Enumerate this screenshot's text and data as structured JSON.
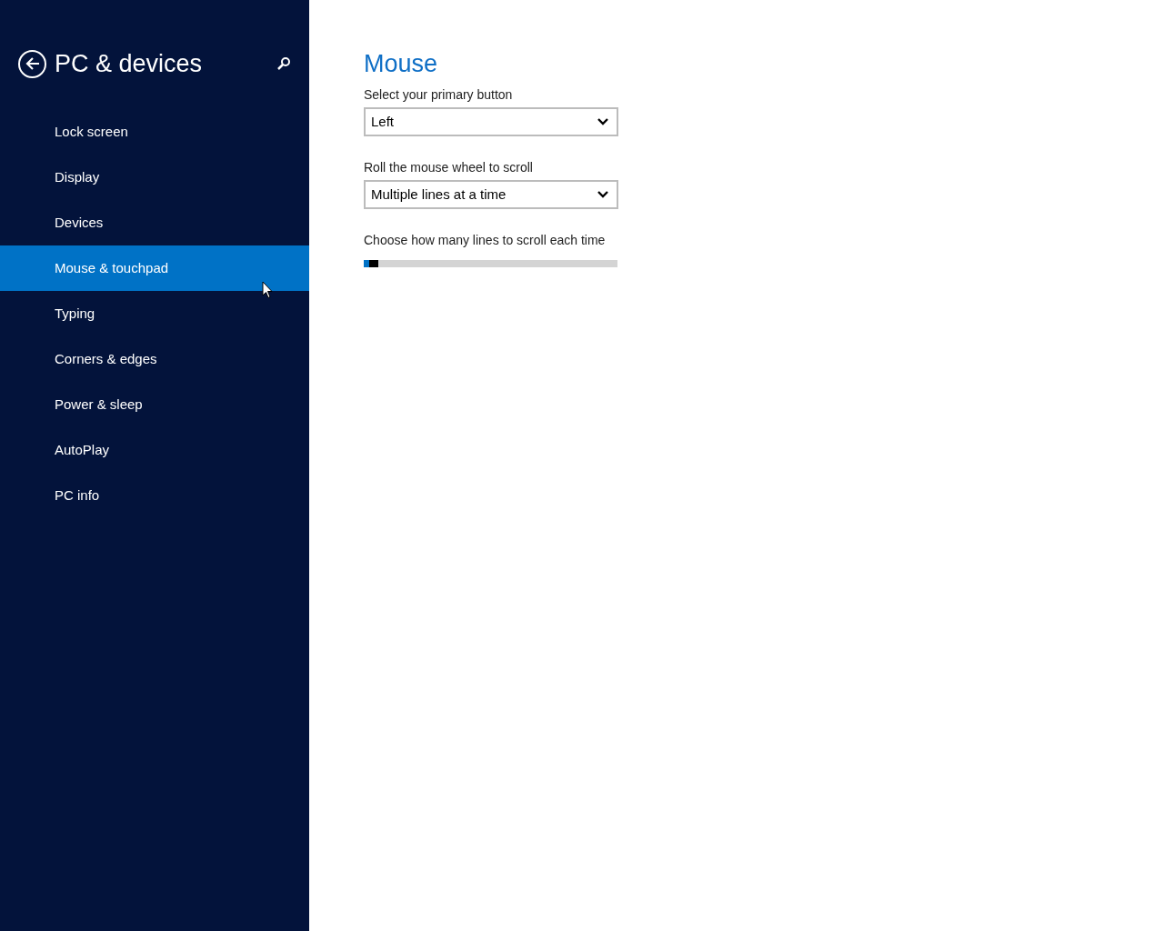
{
  "sidebar": {
    "title": "PC & devices",
    "items": [
      {
        "label": "Lock screen",
        "selected": false
      },
      {
        "label": "Display",
        "selected": false
      },
      {
        "label": "Devices",
        "selected": false
      },
      {
        "label": "Mouse & touchpad",
        "selected": true
      },
      {
        "label": "Typing",
        "selected": false
      },
      {
        "label": "Corners & edges",
        "selected": false
      },
      {
        "label": "Power & sleep",
        "selected": false
      },
      {
        "label": "AutoPlay",
        "selected": false
      },
      {
        "label": "PC info",
        "selected": false
      }
    ]
  },
  "content": {
    "heading": "Mouse",
    "settings": [
      {
        "kind": "dropdown",
        "label": "Select your primary button",
        "value": "Left"
      },
      {
        "kind": "dropdown",
        "label": "Roll the mouse wheel to scroll",
        "value": "Multiple lines at a time"
      },
      {
        "kind": "slider",
        "label": "Choose how many lines to scroll each time",
        "level": 0.02
      }
    ]
  }
}
